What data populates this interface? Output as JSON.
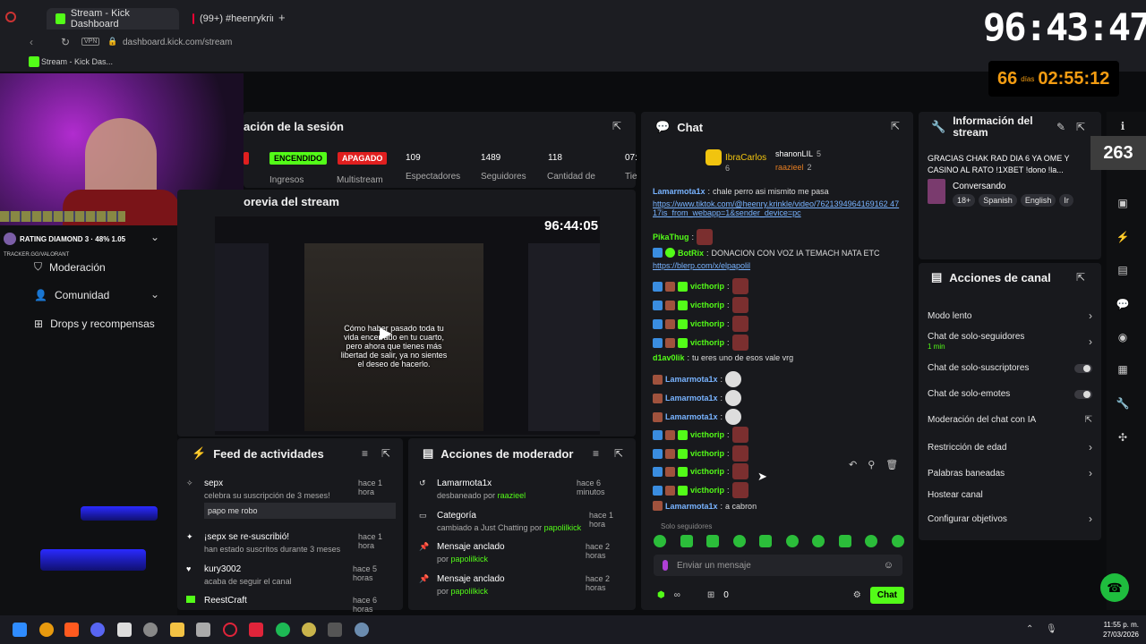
{
  "browser": {
    "tabs": [
      {
        "label": "Stream - Kick Dashboard",
        "active": true
      },
      {
        "label": "(99+) #heenrykrinkle | TikT",
        "active": false
      }
    ],
    "url": "dashboard.kick.com/stream",
    "vpn_label": "VPN",
    "bookmark": "Stream - Kick Das..."
  },
  "overlay": {
    "big_timer": "96:43:47",
    "days_num": "66",
    "days_label": "días",
    "small_timer": "02:55:12",
    "rating_text": "RATING DIAMOND 3 · 48% 1.05",
    "tracker": "TRACKER.GG/VALORANT",
    "counter": "263"
  },
  "sidebar": {
    "items": [
      {
        "label": "Moderación"
      },
      {
        "label": "Comunidad"
      },
      {
        "label": "Drops y recompensas"
      }
    ]
  },
  "session": {
    "title": "ación de la sesión",
    "ingresos_badge": "ENCENDIDO",
    "multistream_badge": "APAGADO",
    "ingresos_label": "Ingresos",
    "multistream_label": "Multistream",
    "stats": [
      {
        "value": "109",
        "label": "Espectadores"
      },
      {
        "value": "1489",
        "label": "Seguidores"
      },
      {
        "value": "118",
        "label": "Cantidad de"
      },
      {
        "value": "07:",
        "label": "Tie"
      }
    ]
  },
  "preview": {
    "title": "orevia del stream",
    "timer": "96:44:05",
    "caption": "Cómo haber pasado toda tu vida encerrado en tu cuarto, pero ahora que tienes más libertad de salir, ya no sientes el deseo de hacerlo."
  },
  "feed": {
    "title": "Feed de actividades",
    "items": [
      {
        "user": "sepx",
        "time": "hace 1 hora",
        "desc": "celebra su suscripción de 3 meses!",
        "message": "papo me robo"
      },
      {
        "user": "¡sepx se re-suscribió!",
        "time": "hace 1 hora",
        "desc": "han estado suscritos durante 3 meses"
      },
      {
        "user": "kury3002",
        "time": "hace 5 horas",
        "desc": "acaba de seguir el canal"
      },
      {
        "user": "ReestCraft",
        "time": "hace 6 horas"
      }
    ]
  },
  "modactions": {
    "title": "Acciones de moderador",
    "items": [
      {
        "title": "Lamarmota1x",
        "time": "hace 6 minutos",
        "desc": "desbaneado por",
        "by": "raazieel"
      },
      {
        "title": "Categoría",
        "time": "hace 1 hora",
        "desc": "cambiado a Just Chatting por",
        "by": "papolilkick"
      },
      {
        "title": "Mensaje anclado",
        "time": "hace 2 horas",
        "desc": "por",
        "by": "papolilkick"
      },
      {
        "title": "Mensaje anclado",
        "time": "hace 2 horas",
        "desc": "por",
        "by": "papolilkick"
      }
    ]
  },
  "chat": {
    "title": "Chat",
    "top_gifters": [
      {
        "name": "IbraCarlos",
        "count": "6"
      },
      {
        "name": "shanonLIL",
        "count": "5"
      },
      {
        "name": "raazieel",
        "count": "2"
      }
    ],
    "messages": [
      {
        "user": "Lamarmota1x",
        "text": "chale perro asi mismito me pasa",
        "blue": true
      },
      {
        "user": "",
        "text": "https://www.tiktok.com/@heenry.krinkle/video/7621394964169162 4717is_from_webapp=1&sender_device=pc",
        "link": true
      },
      {
        "user": "PikaThug",
        "text": ""
      },
      {
        "user": "BotRix",
        "text": "DONACION CON VOZ IA TEMACH NATA ETC"
      },
      {
        "user": "",
        "text": "https://blerp.com/x/elpapolil",
        "link": true
      },
      {
        "user": "victhorip",
        "text": ""
      },
      {
        "user": "victhorip",
        "text": ""
      },
      {
        "user": "victhorip",
        "text": ""
      },
      {
        "user": "victhorip",
        "text": ""
      },
      {
        "user": "d1av0lik",
        "text": "tu eres uno de esos vale vrg"
      },
      {
        "user": "Lamarmota1x",
        "text": "",
        "blue": true
      },
      {
        "user": "Lamarmota1x",
        "text": "",
        "blue": true
      },
      {
        "user": "Lamarmota1x",
        "text": "",
        "blue": true
      },
      {
        "user": "victhorip",
        "text": ""
      },
      {
        "user": "victhorip",
        "text": ""
      },
      {
        "user": "victhorip",
        "text": ""
      },
      {
        "user": "victhorip",
        "text": ""
      },
      {
        "user": "Lamarmota1x",
        "text": "a cabron",
        "blue": true
      }
    ],
    "mode_label": "Solo seguidores",
    "input_placeholder": "Enviar un mensaje",
    "count": "0",
    "send_label": "Chat"
  },
  "info": {
    "title": "Información del stream",
    "stream_title": "GRACIAS CHAK RAD DIA 6 YA OME Y CASINO AL RATO !1XBET !dono !la...",
    "category": "Conversando",
    "tags": [
      "18+",
      "Spanish",
      "English",
      "Ir"
    ]
  },
  "channel_actions": {
    "title": "Acciones de canal",
    "rows": [
      {
        "label": "Modo lento",
        "control": "chevron"
      },
      {
        "label": "Chat de solo-seguidores",
        "sub": "1 min",
        "control": "chevron"
      },
      {
        "label": "Chat de solo-suscriptores",
        "control": "toggle"
      },
      {
        "label": "Chat de solo-emotes",
        "control": "toggle"
      },
      {
        "label": "Moderación del chat con IA",
        "control": "external"
      },
      {
        "label": "Restricción de edad",
        "control": "chevron"
      },
      {
        "label": "Palabras baneadas",
        "control": "chevron"
      },
      {
        "label": "Hostear canal",
        "control": "none"
      },
      {
        "label": "Configurar objetivos",
        "control": "chevron"
      }
    ]
  },
  "taskbar": {
    "time": "11:55 p. m.",
    "date": "27/03/2026"
  },
  "colors": {
    "kick_green": "#53fc18",
    "panel_bg": "#18191d",
    "red_badge": "#e01f1f"
  }
}
